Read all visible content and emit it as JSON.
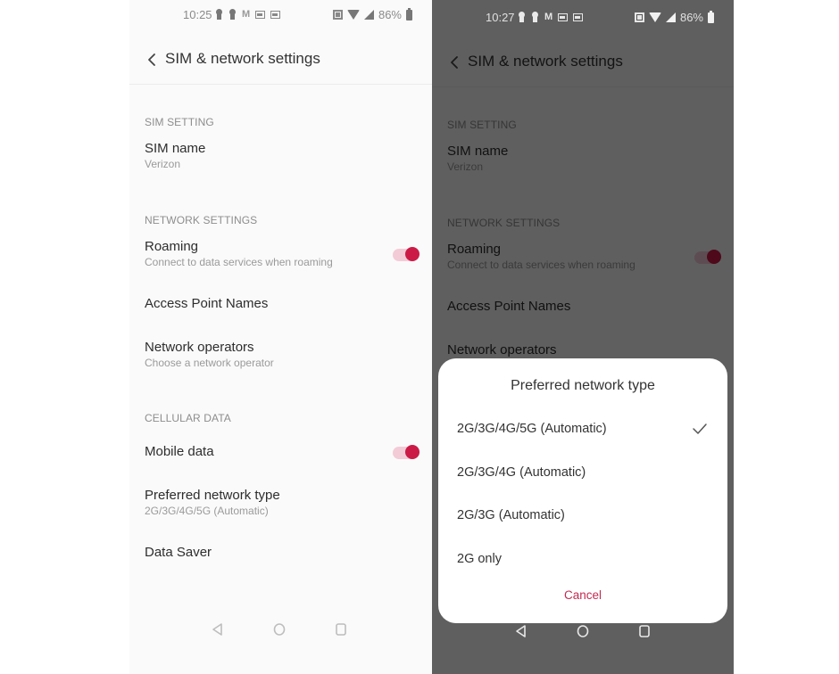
{
  "left_screen": {
    "status": {
      "time": "10:25",
      "battery": "86%"
    },
    "header": {
      "title": "SIM & network settings"
    },
    "sections": {
      "sim": {
        "header": "SIM SETTING",
        "items": [
          {
            "title": "SIM name",
            "subtitle": "Verizon"
          }
        ]
      },
      "network": {
        "header": "NETWORK SETTINGS",
        "items": [
          {
            "title": "Roaming",
            "subtitle": "Connect to data services when roaming",
            "toggle": true
          },
          {
            "title": "Access Point Names"
          },
          {
            "title": "Network operators",
            "subtitle": "Choose a network operator"
          }
        ]
      },
      "cellular": {
        "header": "CELLULAR DATA",
        "items": [
          {
            "title": "Mobile data",
            "toggle": true
          },
          {
            "title": "Preferred network type",
            "subtitle": "2G/3G/4G/5G (Automatic)"
          },
          {
            "title": "Data Saver"
          }
        ]
      }
    }
  },
  "right_screen": {
    "status": {
      "time": "10:27",
      "battery": "86%"
    },
    "header": {
      "title": "SIM & network settings"
    },
    "sections": {
      "sim": {
        "header": "SIM SETTING",
        "items": [
          {
            "title": "SIM name",
            "subtitle": "Verizon"
          }
        ]
      },
      "network": {
        "header": "NETWORK SETTINGS",
        "items": [
          {
            "title": "Roaming",
            "subtitle": "Connect to data services when roaming",
            "toggle": true
          },
          {
            "title": "Access Point Names"
          },
          {
            "title": "Network operators"
          }
        ]
      }
    },
    "dialog": {
      "title": "Preferred network type",
      "options": [
        {
          "label": "2G/3G/4G/5G (Automatic)",
          "selected": true
        },
        {
          "label": "2G/3G/4G (Automatic)",
          "selected": false
        },
        {
          "label": "2G/3G (Automatic)",
          "selected": false
        },
        {
          "label": "2G only",
          "selected": false
        }
      ],
      "cancel": "Cancel"
    }
  },
  "colors": {
    "accent": "#cc1a46",
    "toggle_track": "#f3cbd7",
    "cancel_text": "#c42a52",
    "background": "#fafafa"
  }
}
